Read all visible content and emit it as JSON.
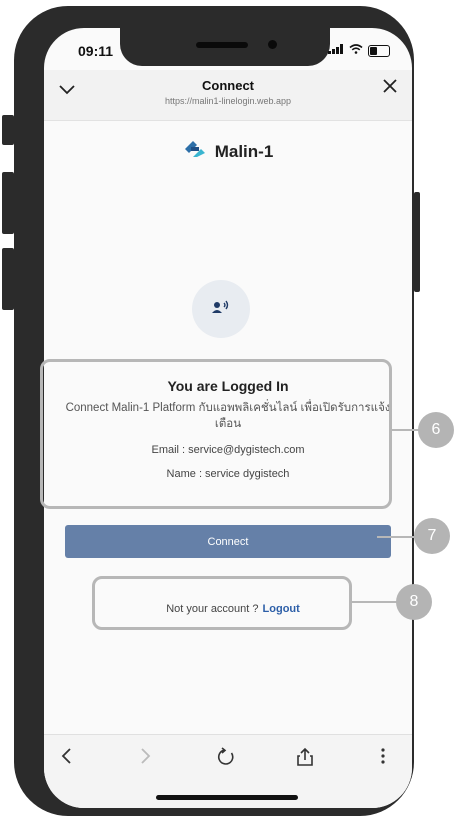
{
  "status_bar": {
    "time": "09:11"
  },
  "browser": {
    "title": "Connect",
    "url": "https://malin1-linelogin.web.app"
  },
  "brand": {
    "name": "Malin-1",
    "accent": "#2d6fa8"
  },
  "card": {
    "title": "You are Logged In",
    "description": "Connect Malin-1 Platform กับแอพพลิเคชั่นไลน์ เพื่อเปิดรับการแจ้งเตือน",
    "email_line": "Email : service@dygistech.com",
    "name_line": "Name : service dygistech"
  },
  "connect_button": {
    "label": "Connect",
    "color": "#6580a8"
  },
  "logout": {
    "prompt": "Not your account ?",
    "link": "Logout"
  },
  "annotations": [
    {
      "number": "6"
    },
    {
      "number": "7"
    },
    {
      "number": "8"
    }
  ],
  "icons": {
    "collapse": "chevron-down-icon",
    "close": "close-icon",
    "back": "chevron-left-icon",
    "forward": "chevron-right-icon",
    "reload": "reload-icon",
    "share": "share-icon",
    "more": "more-vertical-icon"
  }
}
